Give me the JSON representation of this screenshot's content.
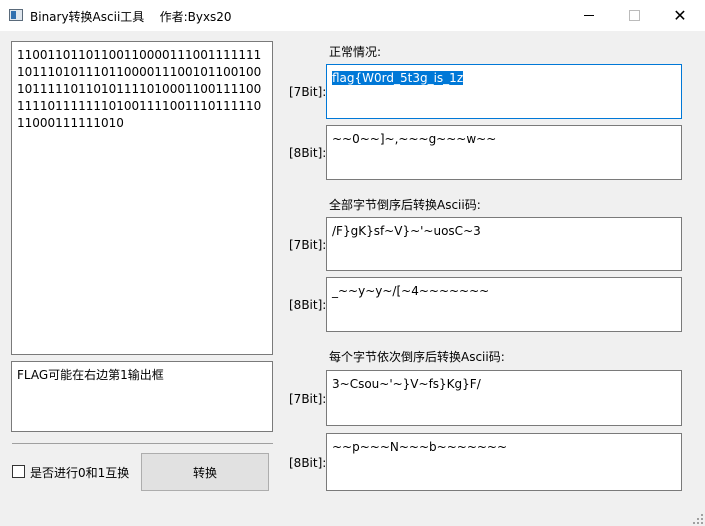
{
  "window": {
    "title": "Binary转换Ascii工具",
    "author": "作者:Byxs20",
    "controls": [
      "minimize-icon",
      "maximize-icon",
      "close-icon"
    ]
  },
  "left": {
    "input_binary": "1100110110110011000011100111111110111010111011000011100101100100101111101101011110100011001111001111011111110100111100111011111011000111111010",
    "hint_text": "FLAG可能在右边第1输出框",
    "checkbox_label": "是否进行0和1互换",
    "checkbox_checked": false,
    "convert_button": "转换"
  },
  "right": {
    "sections": [
      {
        "heading": "正常情况:",
        "label7": "[7Bit]:",
        "value7": "flag{W0rd_5t3g_is_1z",
        "label8": "[8Bit]:",
        "value8": "~~0~~]~,~~~g~~~w~~"
      },
      {
        "heading": "全部字节倒序后转换Ascii码:",
        "label7": "[7Bit]:",
        "value7": "/F}gK}sf~V}~'~uosC~3",
        "label8": "[8Bit]:",
        "value8": "_~~y~y~/[~4~~~~~~~"
      },
      {
        "heading": "每个字节依次倒序后转换Ascii码:",
        "label7": "[7Bit]:",
        "value7": "3~Csou~'~}V~fs}Kg}F/",
        "label8": "[8Bit]:",
        "value8": "~~p~~~N~~~b~~~~~~~"
      }
    ]
  },
  "colors": {
    "selection": "#0078d7",
    "window_bg": "#f0f0f0",
    "button_bg": "#e1e1e1"
  }
}
